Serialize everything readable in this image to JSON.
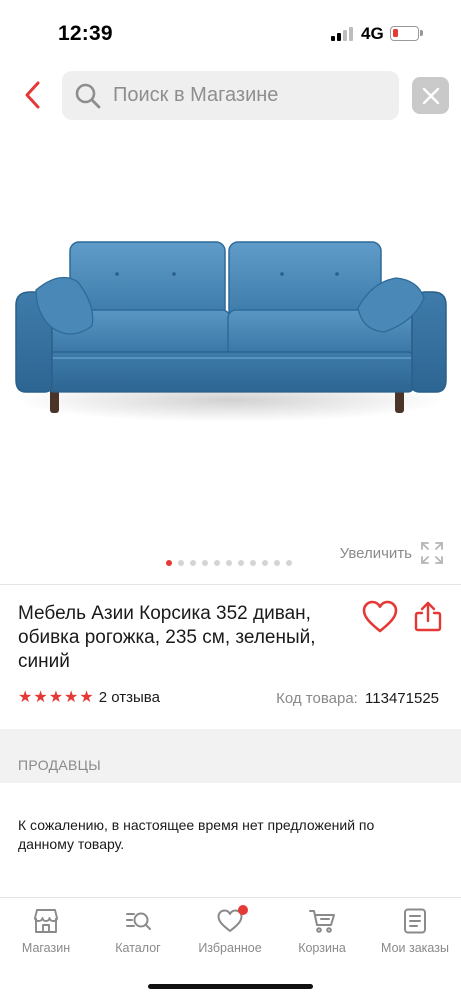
{
  "status_bar": {
    "time": "12:39",
    "network": "4G",
    "battery_level": 0.2,
    "battery_color": "#e53935"
  },
  "search": {
    "placeholder": "Поиск в Магазине",
    "value": "",
    "back_icon": "chevron-left-icon",
    "clear_icon": "close-icon"
  },
  "gallery": {
    "zoom_label": "Увеличить",
    "total_images": 11,
    "active_index": 0,
    "image": "blue-sofa-photo"
  },
  "product": {
    "title": "Мебель Азии Корсика 352 диван, обивка рогожка, 235 см, зеленый, синий",
    "rating": 5,
    "rating_max": 5,
    "reviews": "2 отзыва",
    "code_label": "Код товара:",
    "code_value": "113471525"
  },
  "sellers": {
    "header": "ПРОДАВЦЫ",
    "message": "К сожалению, в настоящее время нет предложений по данному товару."
  },
  "tab_bar": {
    "items": [
      {
        "label": "Магазин",
        "icon": "store-icon"
      },
      {
        "label": "Каталог",
        "icon": "catalog-search-icon"
      },
      {
        "label": "Избранное",
        "icon": "heart-icon",
        "badge": true
      },
      {
        "label": "Корзина",
        "icon": "cart-icon"
      },
      {
        "label": "Мои заказы",
        "icon": "orders-icon"
      }
    ]
  },
  "colors": {
    "accent": "#e53935",
    "sofa": "#3d7fb0",
    "muted_text": "#8a8a8a"
  }
}
